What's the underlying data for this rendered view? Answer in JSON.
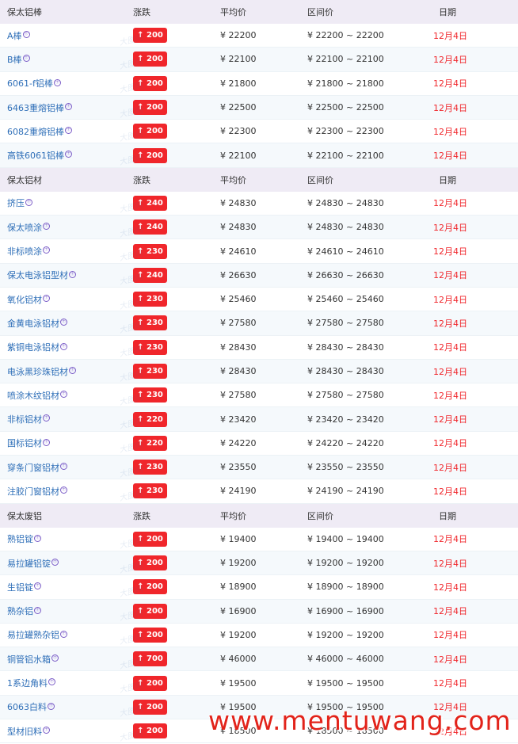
{
  "sections": [
    {
      "header": {
        "name": "保太铝棒",
        "change": "涨跌",
        "avg": "平均价",
        "range": "区间价",
        "date": "日期"
      },
      "rows": [
        {
          "name": "A棒",
          "change": "↑ 200",
          "avg": "¥ 22200",
          "range": "¥ 22200 ~ 22200",
          "date": "12月4日"
        },
        {
          "name": "B棒",
          "change": "↑ 200",
          "avg": "¥ 22100",
          "range": "¥ 22100 ~ 22100",
          "date": "12月4日"
        },
        {
          "name": "6061-f铝棒",
          "change": "↑ 200",
          "avg": "¥ 21800",
          "range": "¥ 21800 ~ 21800",
          "date": "12月4日"
        },
        {
          "name": "6463重熔铝棒",
          "change": "↑ 200",
          "avg": "¥ 22500",
          "range": "¥ 22500 ~ 22500",
          "date": "12月4日"
        },
        {
          "name": "6082重熔铝棒",
          "change": "↑ 200",
          "avg": "¥ 22300",
          "range": "¥ 22300 ~ 22300",
          "date": "12月4日"
        },
        {
          "name": "高铁6061铝棒",
          "change": "↑ 200",
          "avg": "¥ 22100",
          "range": "¥ 22100 ~ 22100",
          "date": "12月4日"
        }
      ]
    },
    {
      "header": {
        "name": "保太铝材",
        "change": "涨跌",
        "avg": "平均价",
        "range": "区间价",
        "date": "日期"
      },
      "rows": [
        {
          "name": "挤压",
          "change": "↑ 240",
          "avg": "¥ 24830",
          "range": "¥ 24830 ~ 24830",
          "date": "12月4日"
        },
        {
          "name": "保太喷涂",
          "change": "↑ 240",
          "avg": "¥ 24830",
          "range": "¥ 24830 ~ 24830",
          "date": "12月4日"
        },
        {
          "name": "非标喷涂",
          "change": "↑ 230",
          "avg": "¥ 24610",
          "range": "¥ 24610 ~ 24610",
          "date": "12月4日"
        },
        {
          "name": "保太电泳铝型材",
          "change": "↑ 240",
          "avg": "¥ 26630",
          "range": "¥ 26630 ~ 26630",
          "date": "12月4日"
        },
        {
          "name": "氧化铝材",
          "change": "↑ 230",
          "avg": "¥ 25460",
          "range": "¥ 25460 ~ 25460",
          "date": "12月4日"
        },
        {
          "name": "金黄电泳铝材",
          "change": "↑ 230",
          "avg": "¥ 27580",
          "range": "¥ 27580 ~ 27580",
          "date": "12月4日"
        },
        {
          "name": "紫铜电泳铝材",
          "change": "↑ 230",
          "avg": "¥ 28430",
          "range": "¥ 28430 ~ 28430",
          "date": "12月4日"
        },
        {
          "name": "电泳黑珍珠铝材",
          "change": "↑ 230",
          "avg": "¥ 28430",
          "range": "¥ 28430 ~ 28430",
          "date": "12月4日"
        },
        {
          "name": "喷涂木纹铝材",
          "change": "↑ 230",
          "avg": "¥ 27580",
          "range": "¥ 27580 ~ 27580",
          "date": "12月4日"
        },
        {
          "name": "非标铝材",
          "change": "↑ 220",
          "avg": "¥ 23420",
          "range": "¥ 23420 ~ 23420",
          "date": "12月4日"
        },
        {
          "name": "国标铝材",
          "change": "↑ 220",
          "avg": "¥ 24220",
          "range": "¥ 24220 ~ 24220",
          "date": "12月4日"
        },
        {
          "name": "穿条门窗铝材",
          "change": "↑ 230",
          "avg": "¥ 23550",
          "range": "¥ 23550 ~ 23550",
          "date": "12月4日"
        },
        {
          "name": "注胶门窗铝材",
          "change": "↑ 230",
          "avg": "¥ 24190",
          "range": "¥ 24190 ~ 24190",
          "date": "12月4日"
        }
      ]
    },
    {
      "header": {
        "name": "保太废铝",
        "change": "涨跌",
        "avg": "平均价",
        "range": "区间价",
        "date": "日期"
      },
      "rows": [
        {
          "name": "熟铝锭",
          "change": "↑ 200",
          "avg": "¥ 19400",
          "range": "¥ 19400 ~ 19400",
          "date": "12月4日"
        },
        {
          "name": "易拉罐铝锭",
          "change": "↑ 200",
          "avg": "¥ 19200",
          "range": "¥ 19200 ~ 19200",
          "date": "12月4日"
        },
        {
          "name": "生铝锭",
          "change": "↑ 200",
          "avg": "¥ 18900",
          "range": "¥ 18900 ~ 18900",
          "date": "12月4日"
        },
        {
          "name": "熟杂铝",
          "change": "↑ 200",
          "avg": "¥ 16900",
          "range": "¥ 16900 ~ 16900",
          "date": "12月4日"
        },
        {
          "name": "易拉罐熟杂铝",
          "change": "↑ 200",
          "avg": "¥ 19200",
          "range": "¥ 19200 ~ 19200",
          "date": "12月4日"
        },
        {
          "name": "铜管铝水箱",
          "change": "↑ 700",
          "avg": "¥ 46000",
          "range": "¥ 46000 ~ 46000",
          "date": "12月4日"
        },
        {
          "name": "1系边角料",
          "change": "↑ 200",
          "avg": "¥ 19500",
          "range": "¥ 19500 ~ 19500",
          "date": "12月4日"
        },
        {
          "name": "6063白料",
          "change": "↑ 200",
          "avg": "¥ 19500",
          "range": "¥ 19500 ~ 19500",
          "date": "12月4日"
        },
        {
          "name": "型材旧料",
          "change": "↑ 200",
          "avg": "¥ 18500",
          "range": "¥ 18500 ~ 18500",
          "date": "12月4日"
        }
      ]
    }
  ],
  "registered_mark": "㊉",
  "row_watermark": "大图网",
  "footer_watermark": "www.mentuwang.com",
  "colors": {
    "header_bg": "#efebf5",
    "row_alt_bg": "#f5f9fc",
    "name_link": "#2f6fb8",
    "badge_red": "#f0262b",
    "date_red": "#f0262b"
  }
}
